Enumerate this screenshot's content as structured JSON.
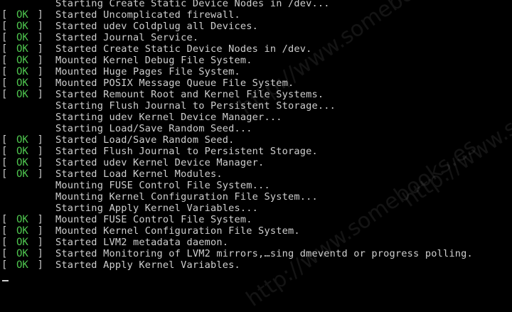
{
  "colors": {
    "background": "#000000",
    "ok": "#4fc74f",
    "text": "#cfcfcf"
  },
  "watermark": "http://www.somebooks.es",
  "status": {
    "open": "[",
    "close": "]",
    "ok": "OK"
  },
  "lines": [
    {
      "ok": false,
      "text": "Starting Create Static Device Nodes in /dev..."
    },
    {
      "ok": true,
      "text": "Started Uncomplicated firewall."
    },
    {
      "ok": true,
      "text": "Started udev Coldplug all Devices."
    },
    {
      "ok": true,
      "text": "Started Journal Service."
    },
    {
      "ok": true,
      "text": "Started Create Static Device Nodes in /dev."
    },
    {
      "ok": true,
      "text": "Mounted Kernel Debug File System."
    },
    {
      "ok": true,
      "text": "Mounted Huge Pages File System."
    },
    {
      "ok": true,
      "text": "Mounted POSIX Message Queue File System."
    },
    {
      "ok": true,
      "text": "Started Remount Root and Kernel File Systems."
    },
    {
      "ok": false,
      "text": "Starting Flush Journal to Persistent Storage..."
    },
    {
      "ok": false,
      "text": "Starting udev Kernel Device Manager..."
    },
    {
      "ok": false,
      "text": "Starting Load/Save Random Seed..."
    },
    {
      "ok": true,
      "text": "Started Load/Save Random Seed."
    },
    {
      "ok": true,
      "text": "Started Flush Journal to Persistent Storage."
    },
    {
      "ok": true,
      "text": "Started udev Kernel Device Manager."
    },
    {
      "ok": true,
      "text": "Started Load Kernel Modules."
    },
    {
      "ok": false,
      "text": "Mounting FUSE Control File System..."
    },
    {
      "ok": false,
      "text": "Mounting Kernel Configuration File System..."
    },
    {
      "ok": false,
      "text": "Starting Apply Kernel Variables..."
    },
    {
      "ok": true,
      "text": "Mounted FUSE Control File System."
    },
    {
      "ok": true,
      "text": "Mounted Kernel Configuration File System."
    },
    {
      "ok": true,
      "text": "Started LVM2 metadata daemon."
    },
    {
      "ok": true,
      "text": "Started Monitoring of LVM2 mirrors,…sing dmeventd or progress polling."
    },
    {
      "ok": true,
      "text": "Started Apply Kernel Variables."
    }
  ]
}
